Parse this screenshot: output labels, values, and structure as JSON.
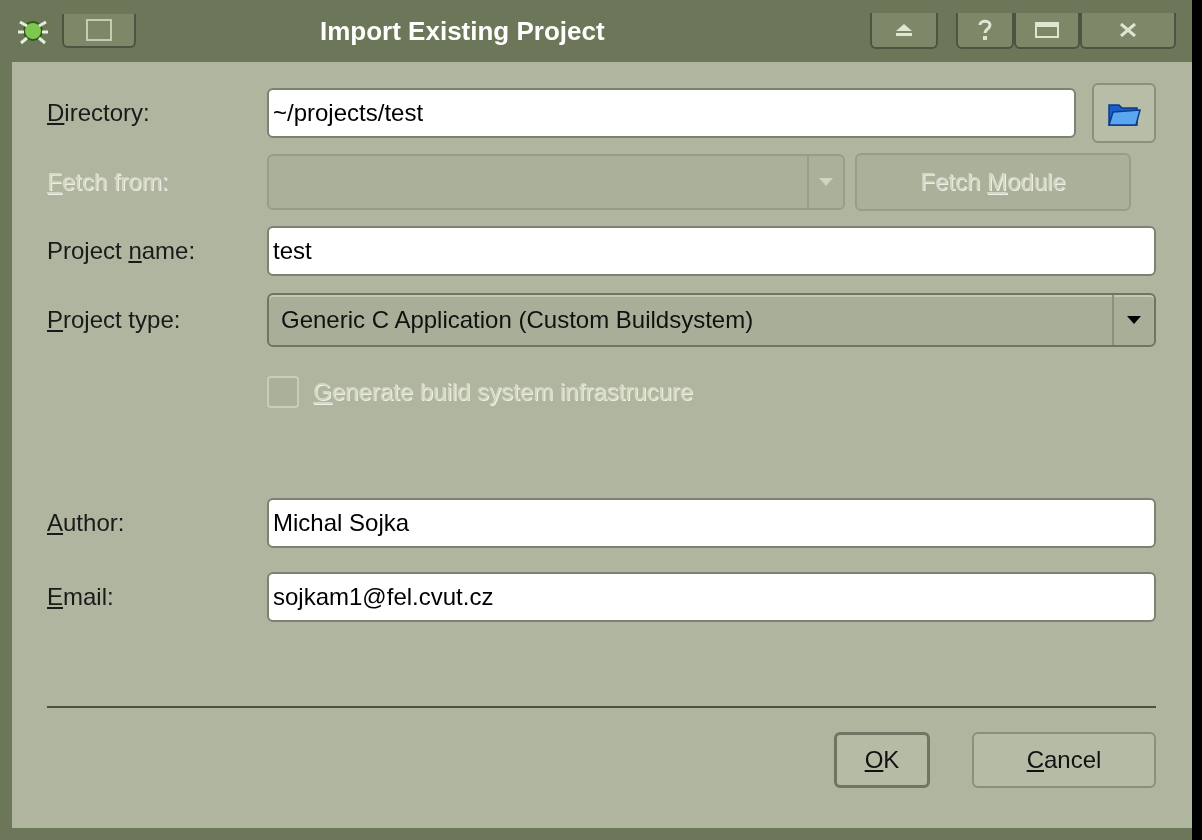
{
  "window": {
    "title": "Import Existing Project"
  },
  "project_fields": [
    {
      "kind": "path",
      "label": {
        "key": "D",
        "after": "irectory:"
      },
      "value": "~/projects/test",
      "disabled": false
    },
    {
      "kind": "fetch",
      "label": {
        "key": "F",
        "after": "etch from:"
      },
      "disabled": true,
      "button": {
        "before": "Fetch ",
        "key": "M",
        "after": "odule"
      }
    },
    {
      "kind": "text",
      "label": {
        "before": "Project ",
        "key": "n",
        "after": "ame:"
      },
      "value": "test",
      "disabled": false
    },
    {
      "kind": "combo",
      "label": {
        "key": "P",
        "after": "roject type:"
      },
      "value": "Generic C Application (Custom Buildsystem)"
    },
    {
      "kind": "checkbox",
      "label": {
        "key": "G",
        "after": "enerate build system infrastrucure"
      },
      "checked": false,
      "disabled": true
    }
  ],
  "author_fields": [
    {
      "kind": "text",
      "label": {
        "key": "A",
        "after": "uthor:"
      },
      "value": "Michal Sojka",
      "disabled": false
    },
    {
      "kind": "text",
      "label": {
        "key": "E",
        "after": "mail:"
      },
      "value": "sojkam1@fel.cvut.cz",
      "disabled": false
    }
  ],
  "buttons": [
    {
      "label": {
        "key": "O",
        "after": "K"
      },
      "default": true
    },
    {
      "label": {
        "key": "C",
        "after": "ancel"
      },
      "default": false
    }
  ]
}
